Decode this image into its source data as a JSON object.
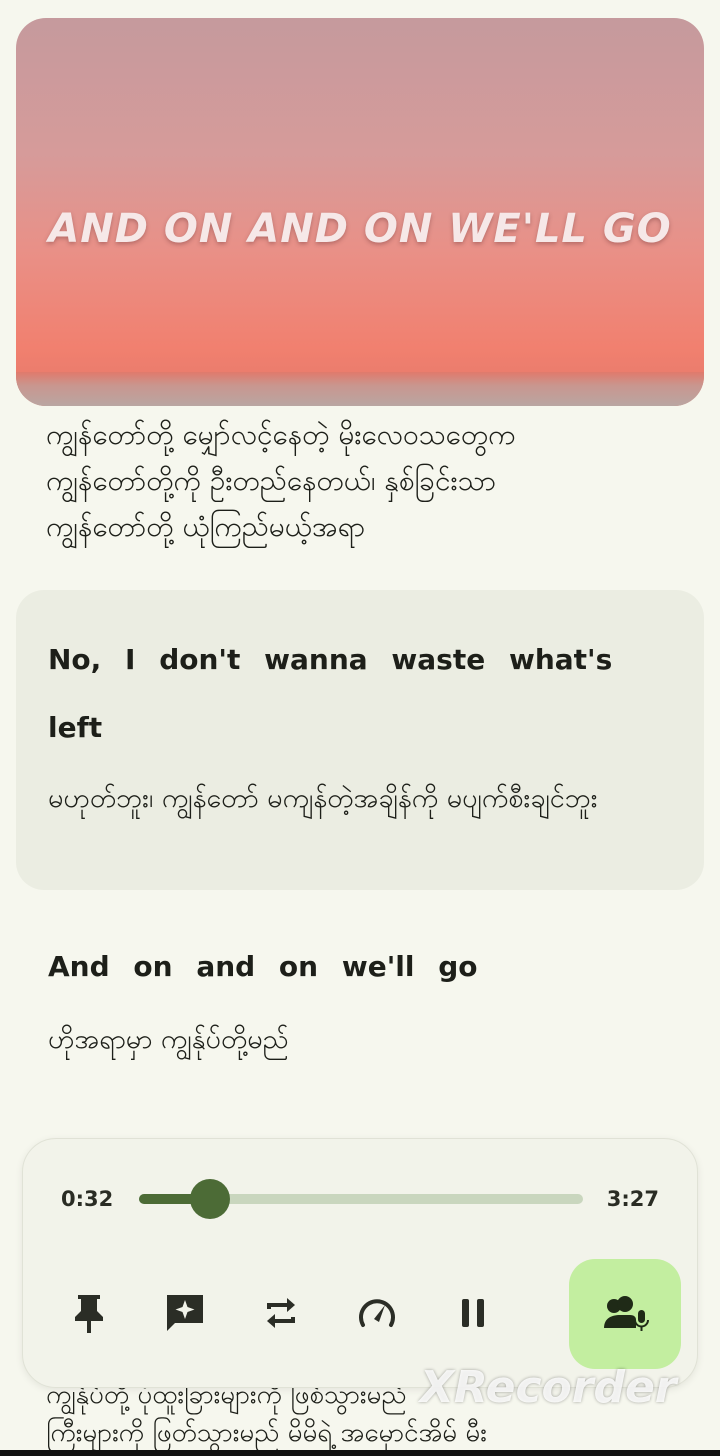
{
  "cover": {
    "text": "AND ON AND ON WE'LL GO"
  },
  "intro": {
    "lines": [
      "ကျွန်တော်တို့ မျှော်လင့်နေတဲ့ မိုးလေဝသတွေက",
      "ကျွန်တော်တို့ကို ဦးတည်နေတယ်၊ နှစ်ခြင်းသာ",
      "ကျွန်တော်တို့ ယုံကြည်မယ့်အရာ"
    ]
  },
  "lyrics": {
    "active": {
      "english": "No, I don't wanna waste what's left",
      "translation": "မဟုတ်ဘူး၊ ကျွန်တော် မကျန်တဲ့အချိန်ကို မပျက်စီးချင်ဘူး"
    },
    "next": {
      "english": "And on and on we'll go",
      "translation": "ဟိုအရာမှာ ကျွန်ုပ်တို့မည်"
    },
    "below": {
      "lines": [
        "ကျွန်ုပ်တို့ ပုံထူးခြားများကို ဖြစ်သွားမည်",
        "ကြီးများကို ဖြတ်သွားမည် မိမိရဲ့ အမှောင်အိမ် မီး"
      ]
    }
  },
  "player": {
    "current_time": "0:32",
    "total_time": "3:27",
    "progress": 0.16,
    "controls": {
      "pin": "pin-icon",
      "ai": "sparkle-comment-icon",
      "repeat": "repeat-icon",
      "speed": "speed-gauge-icon",
      "pause": "pause-icon",
      "voice": "voice-person-mic-icon"
    },
    "colors": {
      "accent": "#4c6b36",
      "track": "#c9d6be",
      "voice_button": "#c3eea0"
    }
  },
  "watermark": {
    "text": "XRecorder"
  }
}
